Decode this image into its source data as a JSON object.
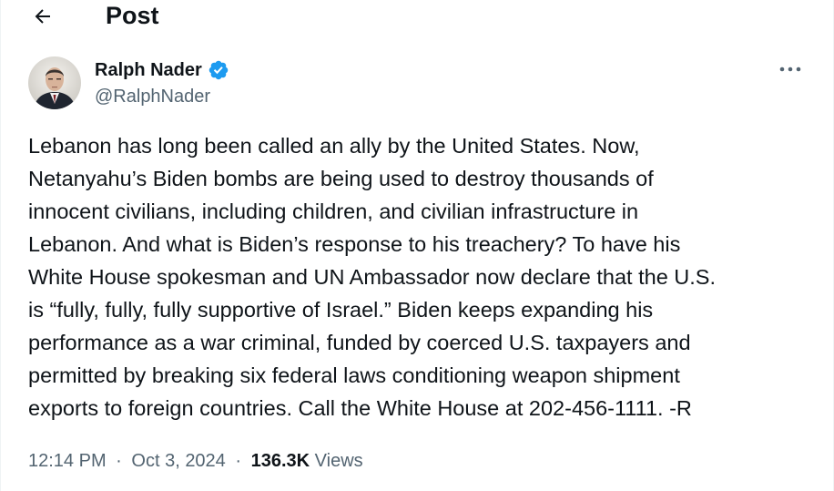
{
  "header": {
    "title": "Post"
  },
  "author": {
    "display_name": "Ralph Nader",
    "handle": "@RalphNader",
    "verified": true
  },
  "tweet": {
    "text": "Lebanon has long been called an ally by the United States. Now,\nNetanyahu’s Biden bombs are being used to destroy thousands of\ninnocent civilians, including children, and civilian infrastructure in\nLebanon. And what is Biden’s response to his treachery? To have his\nWhite House spokesman and UN Ambassador now declare that the U.S.\nis “fully, fully, fully supportive of Israel.” Biden keeps expanding his\nperformance as a war criminal, funded by coerced U.S. taxpayers and\npermitted by breaking six federal laws conditioning weapon shipment\nexports to foreign countries. Call the White House at 202-456-1111. -R"
  },
  "meta": {
    "time": "12:14 PM",
    "separator": "·",
    "date": "Oct 3, 2024",
    "views_count": "136.3K",
    "views_label": "Views"
  },
  "colors": {
    "text_primary": "#0f1419",
    "text_secondary": "#536471",
    "verified_blue": "#1d9bf0"
  },
  "icons": {
    "back": "arrow-left-icon",
    "verified": "verified-badge-icon",
    "more": "more-horizontal-icon"
  }
}
